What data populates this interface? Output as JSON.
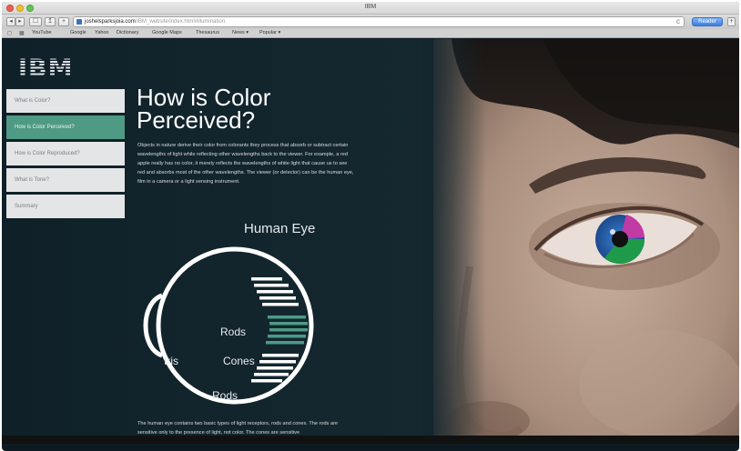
{
  "window": {
    "title": "IBM"
  },
  "toolbar": {
    "back_label": "◂",
    "forward_label": "▸",
    "sidebar_label": "☐",
    "share_label": "↥",
    "add_label": "+",
    "url_host": "joshelsparksjoia.com",
    "url_path": "/IBM_website/index.html#illumination",
    "reload_label": "c",
    "reader_label": "Reader",
    "extra_label": "+"
  },
  "bookmarks": {
    "items": [
      "YouTube",
      "Google",
      "Yahoo",
      "Dictionary",
      "Google Maps",
      "Thesaurus",
      "News ▾",
      "Popular ▾"
    ]
  },
  "site": {
    "logo": "IBM",
    "nav": [
      {
        "label": "What is Color?",
        "active": false
      },
      {
        "label": "How is Color Perceived?",
        "active": true
      },
      {
        "label": "How is Color Reproduced?",
        "active": false
      },
      {
        "label": "What is Tone?",
        "active": false
      },
      {
        "label": "Summary",
        "active": false
      }
    ],
    "heading": "How is Color Perceived?",
    "body": "Objects in nature derive their color from colorants they process that absorb or subtract certain wavelengths of light while reflecting other wavelengths back to the viewer. For example, a red apple really has no color, it merely reflects the wavelengths of white light that cause us to see red and absorbs most of the other wavelengths. The viewer (or detector) can be the human eye, film in a camera or a light sensing instrument.",
    "diagram": {
      "title": "Human Eye",
      "iris_label": "Iris",
      "rods_top_label": "Rods",
      "cones_label": "Cones",
      "rods_bottom_label": "Rods"
    },
    "footer": "The human eye contains two basic types of light receptors, rods and cones. The rods are sensitive only to the presence of light, not color. The cones are sensitive"
  },
  "colors": {
    "background": "#13262e",
    "accent": "#4f9a85",
    "nav_bg": "#e4e5e6",
    "eye_iris_blue": "#2f6fc8",
    "eye_iris_green": "#1f9a49",
    "eye_iris_magenta": "#c23aa4"
  }
}
